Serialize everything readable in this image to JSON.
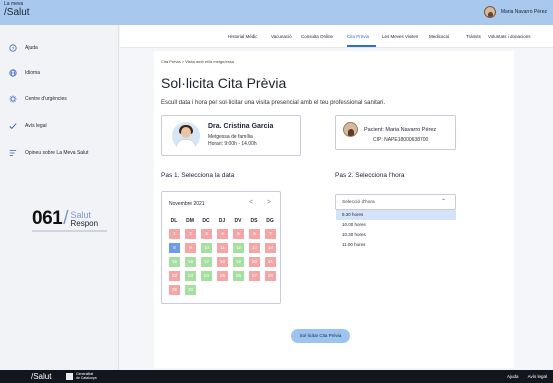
{
  "app": {
    "logo_top": "La meva",
    "logo_main": "/Salut",
    "user_name": "Maria Navarro Pérez"
  },
  "sidebar": {
    "items": [
      {
        "label": "Ajuda",
        "icon": "help-icon"
      },
      {
        "label": "Idioma",
        "icon": "globe-icon"
      },
      {
        "label": "Centre d'urgències",
        "icon": "gear-icon"
      },
      {
        "label": "Avís legal",
        "icon": "check-icon"
      },
      {
        "label": "Opineu sobre La Meva Salut",
        "icon": "comment-icon"
      }
    ],
    "brand": {
      "number": "061",
      "slash": "/",
      "line1": "Salut",
      "line2": "Respon"
    }
  },
  "nav": {
    "items": [
      {
        "label": "Historial Mèdic"
      },
      {
        "label": "Vacunació"
      },
      {
        "label": "Consulta Online"
      },
      {
        "label": "Cita Prèvia"
      },
      {
        "label": "Les Meves Visites"
      },
      {
        "label": "Medicació"
      },
      {
        "label": "Tràmits"
      },
      {
        "label": "Voluntats i donacions"
      }
    ],
    "active": "Cita Prèvia"
  },
  "main": {
    "breadcrumb": "Cita Prèvia  >  Visita amb el/la metge/essa",
    "title": "Sol·licita Cita Prèvia",
    "intro": "Escull data i hora per sol·licitar una visita presencial amb el teu professional sanitari.",
    "doctor": {
      "name": "Dra. Cristina Garcia",
      "role": "Metgessa de família",
      "hours": "Horari: 9:00h - 14.00h"
    },
    "patient": {
      "name": "Pacient: Maria Navarro Pérez",
      "cip": "CIP: NAPE18000638700"
    },
    "step1": "Pas 1. Selecciona la data",
    "step2": "Pas 2. Selecciona l'hora",
    "calendar": {
      "month": "Novembre 2021",
      "prev": "<",
      "next": ">",
      "weekdays": [
        "DL",
        "DM",
        "DC",
        "DJ",
        "DV",
        "DS",
        "DG"
      ],
      "days": [
        {
          "n": "1",
          "s": "busy"
        },
        {
          "n": "2",
          "s": "busy"
        },
        {
          "n": "3",
          "s": "busy"
        },
        {
          "n": "4",
          "s": "busy"
        },
        {
          "n": "5",
          "s": "busy"
        },
        {
          "n": "6",
          "s": "busy"
        },
        {
          "n": "7",
          "s": "busy"
        },
        {
          "n": "8",
          "s": "selected"
        },
        {
          "n": "9",
          "s": "busy"
        },
        {
          "n": "10",
          "s": "free"
        },
        {
          "n": "11",
          "s": "busy"
        },
        {
          "n": "12",
          "s": "free"
        },
        {
          "n": "13",
          "s": "busy"
        },
        {
          "n": "14",
          "s": "busy"
        },
        {
          "n": "15",
          "s": "free"
        },
        {
          "n": "16",
          "s": "free"
        },
        {
          "n": "17",
          "s": "free"
        },
        {
          "n": "18",
          "s": "busy"
        },
        {
          "n": "19",
          "s": "free"
        },
        {
          "n": "20",
          "s": "busy"
        },
        {
          "n": "21",
          "s": "busy"
        },
        {
          "n": "22",
          "s": "busy"
        },
        {
          "n": "23",
          "s": "free"
        },
        {
          "n": "24",
          "s": "free"
        },
        {
          "n": "25",
          "s": "busy"
        },
        {
          "n": "26",
          "s": "free"
        },
        {
          "n": "27",
          "s": "busy"
        },
        {
          "n": "28",
          "s": "busy"
        },
        {
          "n": "29",
          "s": "busy"
        },
        {
          "n": "30",
          "s": "free"
        }
      ]
    },
    "time_select": {
      "placeholder": "Selecció d'hora",
      "options": [
        {
          "label": "9.30 hores",
          "active": true
        },
        {
          "label": "10.00 hores",
          "active": false
        },
        {
          "label": "10.30 hores",
          "active": false
        },
        {
          "label": "11.00 hores",
          "active": false
        }
      ]
    },
    "submit_label": "Sol·licitar Cita Prèvia"
  },
  "footer": {
    "logo": "/Salut",
    "gen_line1": "Generalitat",
    "gen_line2": "de Catalunya",
    "links": [
      "Ajuda",
      "Avís legal"
    ]
  },
  "colors": {
    "accent": "#2d6fd6",
    "topbar": "#a9c8ee",
    "busy": "#f4a6a6",
    "free": "#a6e0a0",
    "selected": "#6f9be8"
  }
}
